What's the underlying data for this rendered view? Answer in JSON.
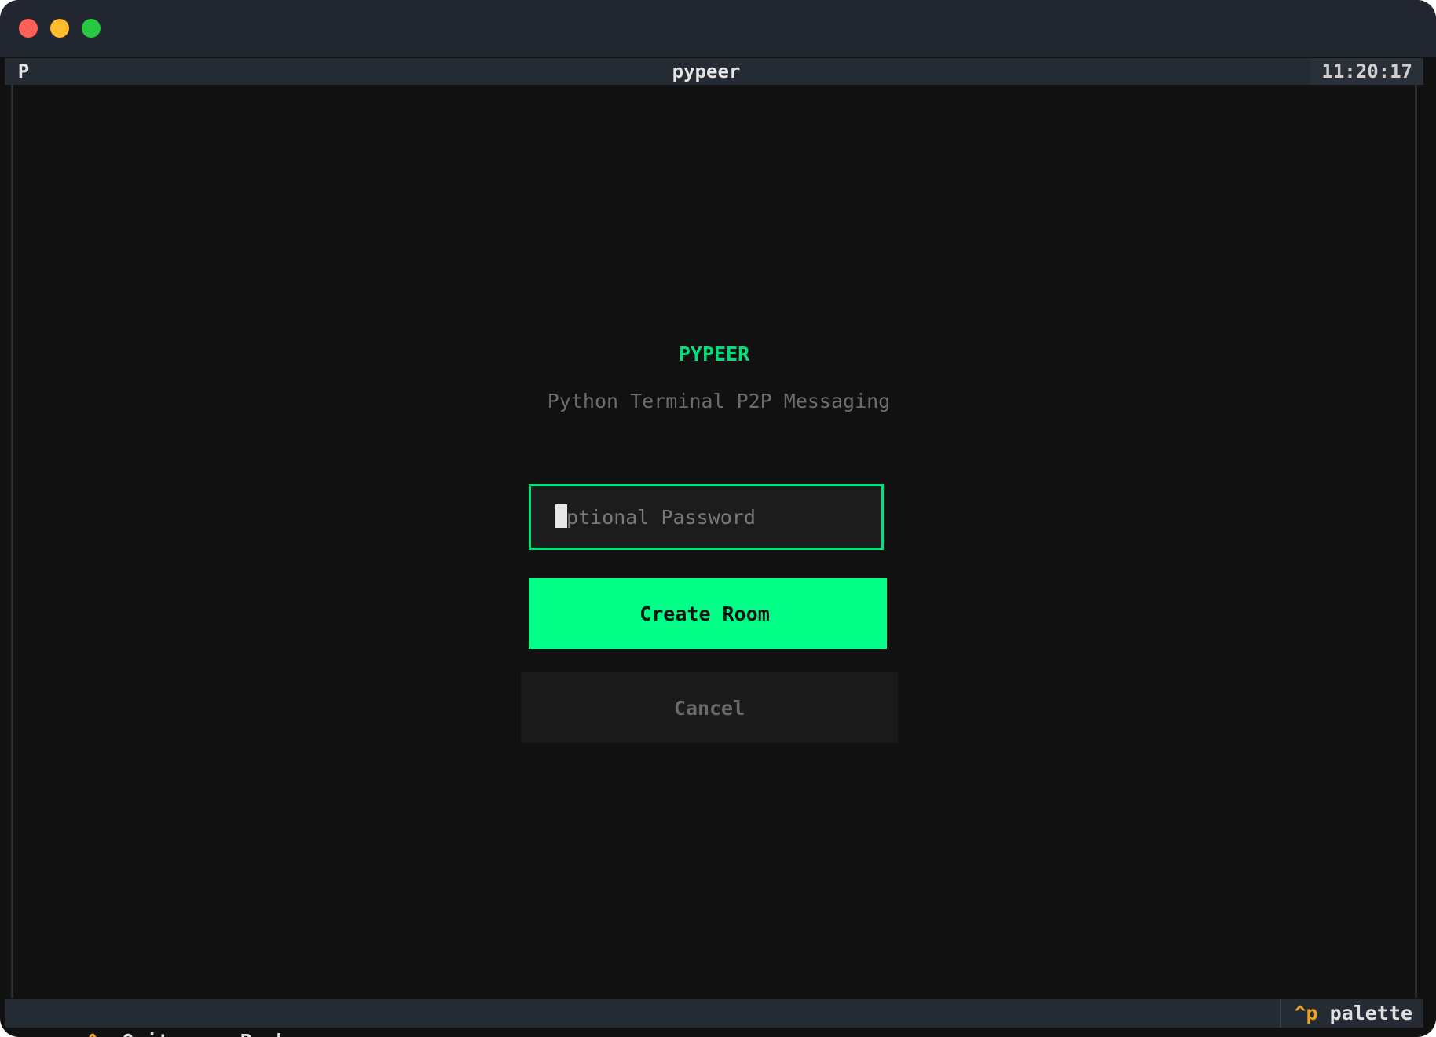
{
  "window": {
    "title": "pypeer",
    "icon_letter": "P",
    "clock": "11:20:17"
  },
  "app": {
    "name": "PYPEER",
    "tagline": "Python Terminal P2P Messaging"
  },
  "form": {
    "password_placeholder": "Optional Password",
    "password_value": "",
    "create_label": "Create Room",
    "cancel_label": "Cancel"
  },
  "footer": {
    "bindings": [
      {
        "key": "^q",
        "label": "Quit"
      },
      {
        "key": "esc",
        "label": "Back"
      }
    ],
    "palette": {
      "key": "^p",
      "label": "palette"
    }
  },
  "colors": {
    "accent": "#00ff87",
    "accent_border": "#00e07a",
    "key_highlight": "#f0a020",
    "background": "#111111",
    "header_bg": "#242b33"
  }
}
